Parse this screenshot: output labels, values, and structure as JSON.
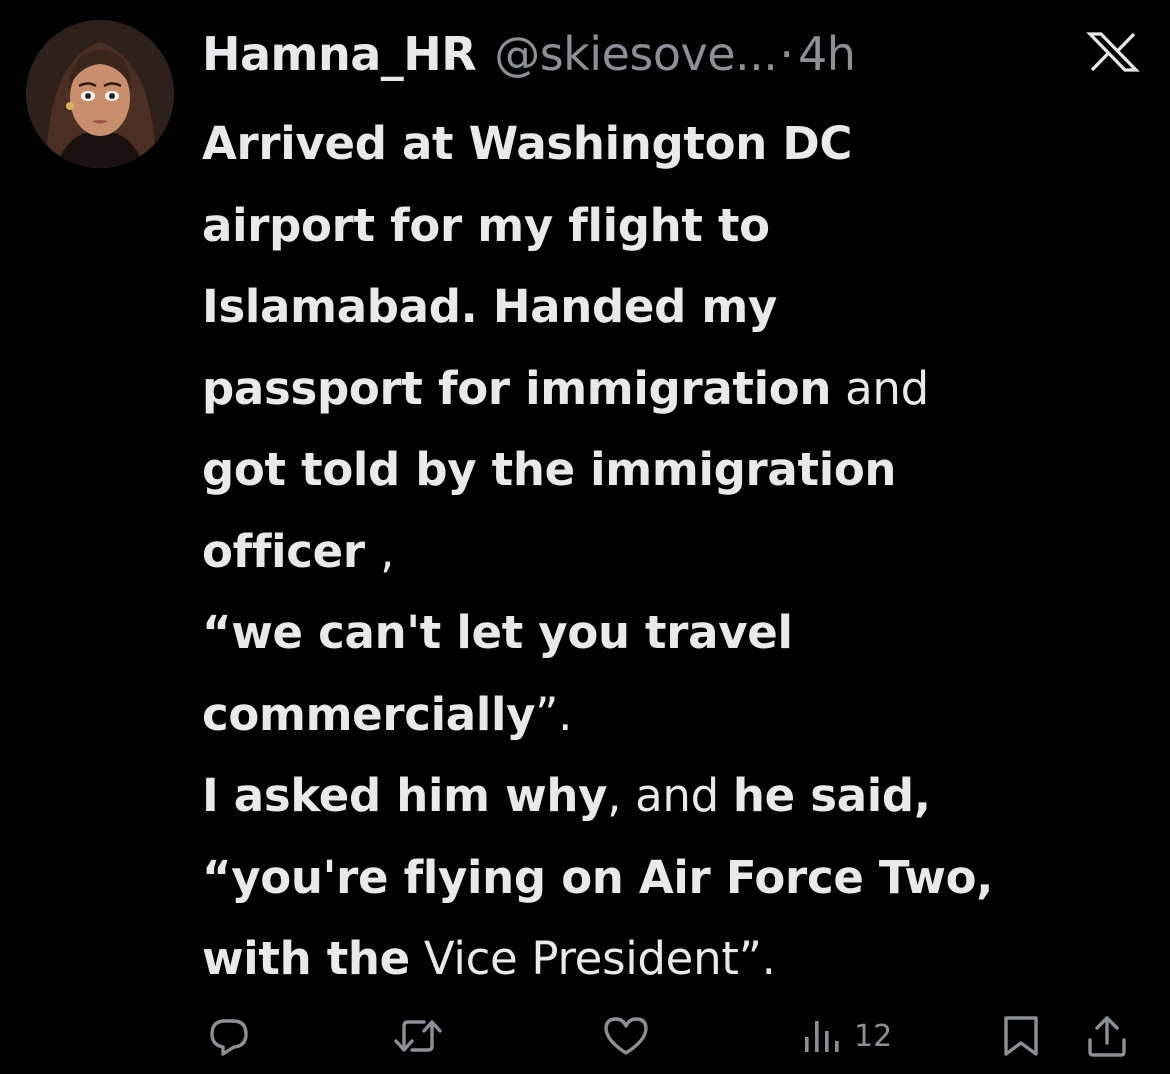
{
  "tweet": {
    "display_name": "Hamna_HR",
    "handle": "@skiesove...",
    "separator": "·",
    "time": "4h",
    "lines": [
      [
        {
          "t": "Arrived at Washington DC",
          "w": "b"
        }
      ],
      [
        {
          "t": "airport for my flight to",
          "w": "b"
        }
      ],
      [
        {
          "t": "Islamabad. Handed my",
          "w": "b"
        }
      ],
      [
        {
          "t": "passport for immigration",
          "w": "b"
        },
        {
          "t": " and",
          "w": "n"
        }
      ],
      [
        {
          "t": "got told by the immigration",
          "w": "b"
        }
      ],
      [
        {
          "t": "officer ",
          "w": "b"
        },
        {
          "t": ",",
          "w": "n"
        }
      ],
      [
        {
          "t": "“we can't let you travel",
          "w": "b"
        }
      ],
      [
        {
          "t": "commercially",
          "w": "b"
        },
        {
          "t": "”.",
          "w": "n"
        }
      ],
      [
        {
          "t": "I asked him why",
          "w": "b"
        },
        {
          "t": ", and ",
          "w": "n"
        },
        {
          "t": "he said,",
          "w": "b"
        }
      ],
      [
        {
          "t": "“you're flying on Air Force Two,",
          "w": "b"
        }
      ],
      [
        {
          "t": "with the",
          "w": "b"
        },
        {
          "t": " Vice President”.",
          "w": "n"
        }
      ]
    ]
  },
  "actions": {
    "reply_icon": "reply-icon",
    "retweet_icon": "retweet-icon",
    "like_icon": "heart-icon",
    "views_icon": "views-bar-chart-icon",
    "views_count": "12",
    "bookmark_icon": "bookmark-icon",
    "share_icon": "share-icon"
  },
  "icons": {
    "brand_logo": "x-logo-icon"
  },
  "colors": {
    "background": "#000000",
    "text_primary": "#e7e9ea",
    "text_secondary": "#8b9095"
  }
}
